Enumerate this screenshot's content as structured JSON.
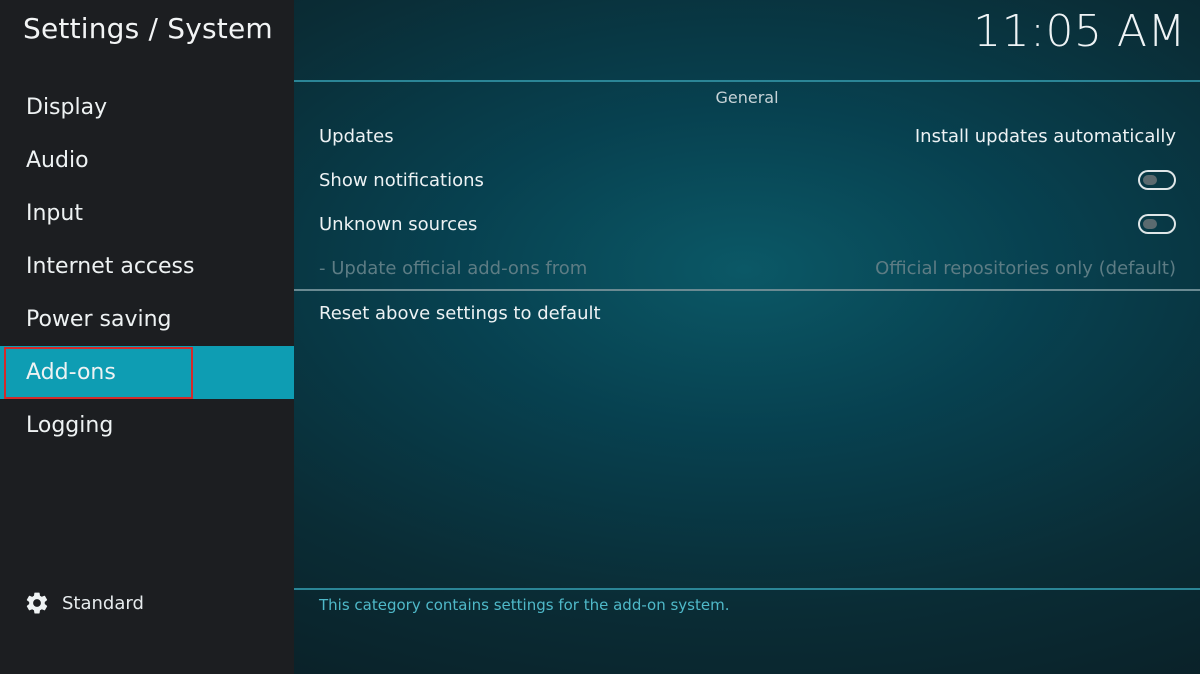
{
  "header": {
    "title": "Settings / System",
    "clock": "11:05 AM"
  },
  "sidebar": {
    "items": [
      {
        "label": "Display"
      },
      {
        "label": "Audio"
      },
      {
        "label": "Input"
      },
      {
        "label": "Internet access"
      },
      {
        "label": "Power saving"
      },
      {
        "label": "Add-ons",
        "active": true
      },
      {
        "label": "Logging"
      }
    ],
    "level_label": "Standard",
    "level_icon": "gear-icon"
  },
  "main": {
    "section_title": "General",
    "settings": [
      {
        "label": "Updates",
        "value": "Install updates automatically"
      },
      {
        "label": "Show notifications",
        "toggle": false
      },
      {
        "label": "Unknown sources",
        "toggle": false
      },
      {
        "label": "- Update official add-ons from",
        "value": "Official repositories only (default)",
        "disabled": true
      }
    ],
    "reset_label": "Reset above settings to default",
    "description": "This category contains settings for the add-on system."
  },
  "colors": {
    "accent": "#0e9db3",
    "highlight_border": "#d42a2a",
    "sidebar_bg": "#1c1e21",
    "description_text": "#4fb9c9"
  }
}
